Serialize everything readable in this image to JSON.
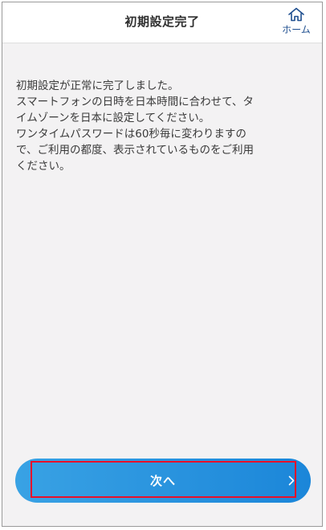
{
  "header": {
    "title": "初期設定完了",
    "home_label": "ホーム"
  },
  "message": {
    "lines": [
      "初期設定が正常に完了しました。",
      "スマートフォンの日時を日本時間に合わせて、タ",
      "イムゾーンを日本に設定してください。",
      "ワンタイムパスワードは60秒毎に変わりますの",
      "で、ご利用の都度、表示されているものをご利用",
      "ください。"
    ]
  },
  "footer": {
    "next_label": "次へ"
  },
  "colors": {
    "background": "#f3f2f3",
    "button_start": "#39a2e4",
    "button_end": "#1b86d9",
    "highlight": "#e8102a",
    "home_icon": "#1f4f8f"
  },
  "icons": {
    "home": "home-icon",
    "next": "chevron-right-icon"
  }
}
